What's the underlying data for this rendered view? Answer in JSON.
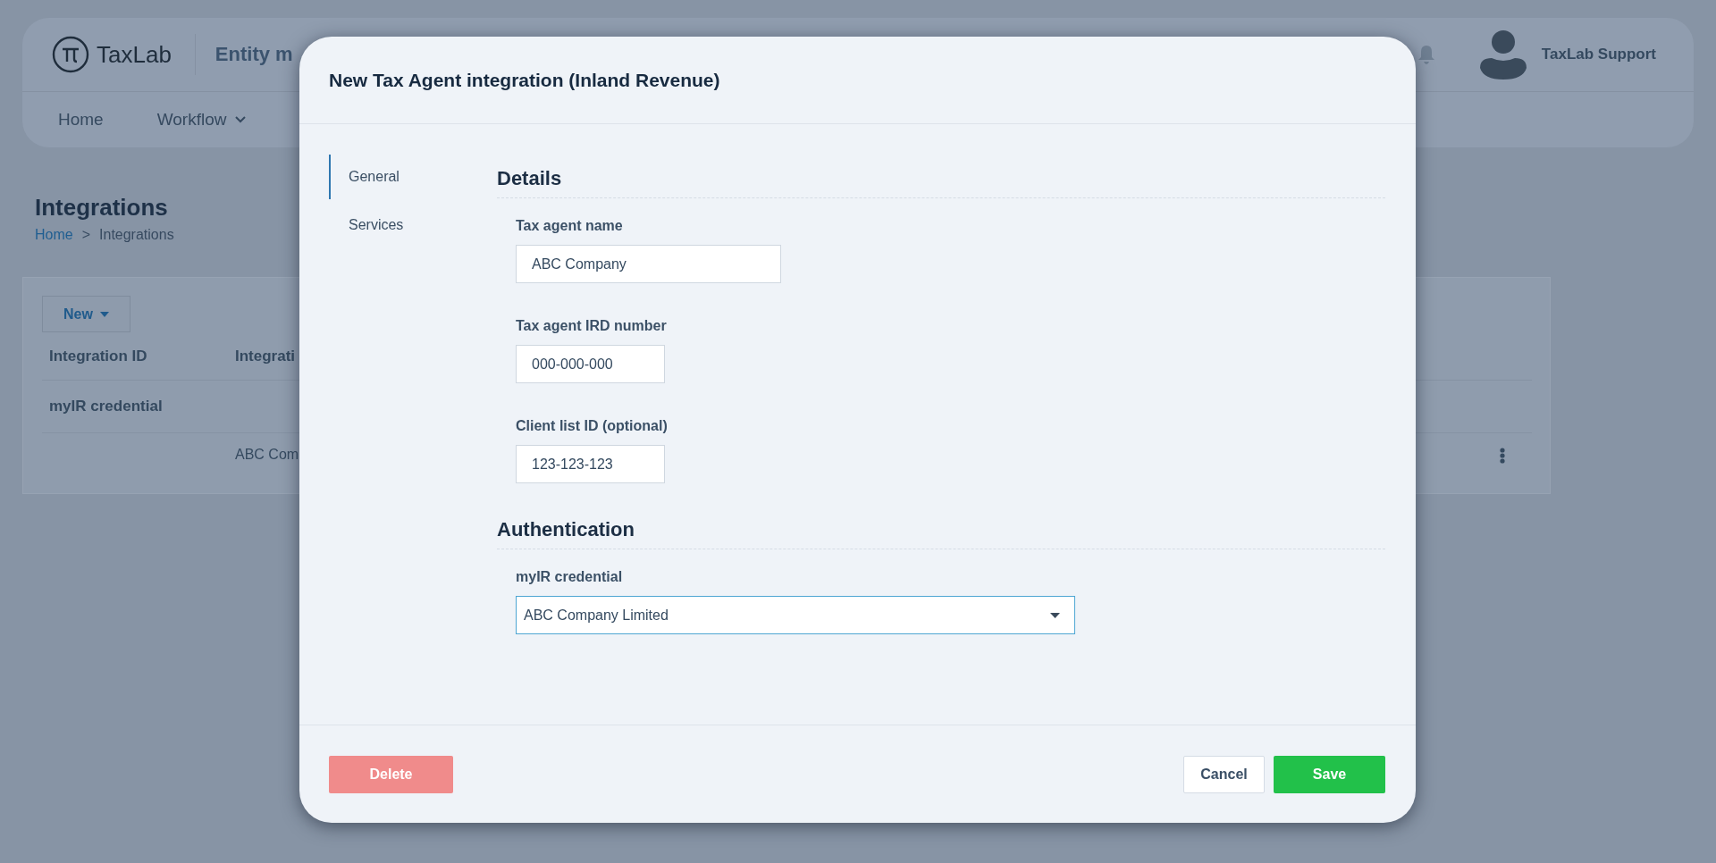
{
  "header": {
    "logo_text": "TaxLab",
    "app_title": "Entity m",
    "user_name": "TaxLab Support",
    "nav": [
      {
        "label": "Home",
        "kind": "link"
      },
      {
        "label": "Workflow",
        "kind": "dropdown"
      }
    ]
  },
  "page": {
    "title": "Integrations",
    "breadcrumb": {
      "items": [
        {
          "label": "Home",
          "kind": "link"
        },
        {
          "label": "Integrations",
          "kind": "current"
        }
      ],
      "separator": ">"
    },
    "new_button": "New",
    "table": {
      "columns": [
        "Integration ID",
        "Integrati"
      ],
      "rows": [
        {
          "kind": "group",
          "label": "myIR credential"
        },
        {
          "kind": "item",
          "column_2": "ABC Com"
        }
      ]
    }
  },
  "dialog": {
    "title": "New Tax Agent integration (Inland Revenue)",
    "tabs": [
      {
        "label": "General",
        "selected": true
      },
      {
        "label": "Services",
        "selected": false
      }
    ],
    "sections": [
      {
        "heading": "Details",
        "fields": [
          {
            "label": "Tax agent name",
            "value": "ABC Company",
            "kind": "text"
          },
          {
            "label": "Tax agent IRD number",
            "value": "000-000-000",
            "kind": "short"
          },
          {
            "label": "Client list ID (optional)",
            "value": "123-123-123",
            "kind": "short"
          }
        ]
      },
      {
        "heading": "Authentication",
        "fields": [
          {
            "label": "myIR credential",
            "value": "ABC Company Limited",
            "kind": "select"
          }
        ]
      }
    ],
    "buttons": [
      {
        "label": "Delete",
        "kind": "danger"
      },
      {
        "label": "Cancel",
        "kind": "secondary"
      },
      {
        "label": "Save",
        "kind": "primary"
      }
    ]
  }
}
